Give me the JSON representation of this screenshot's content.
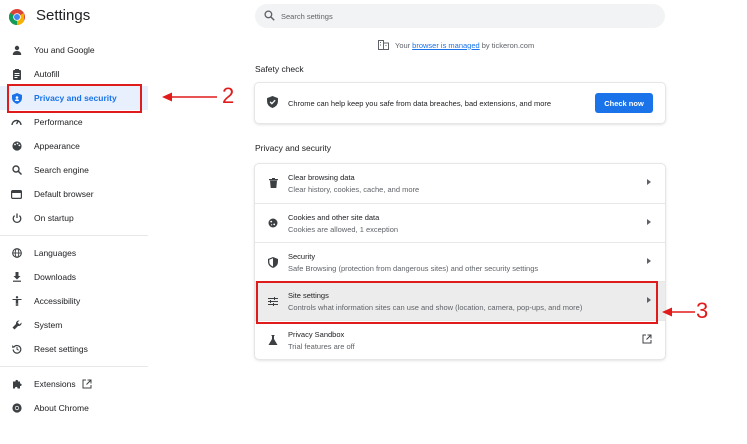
{
  "header": {
    "title": "Settings",
    "logo_icon": "chrome-logo-icon"
  },
  "sidebar": {
    "items": [
      {
        "label": "You and Google",
        "icon": "person-icon"
      },
      {
        "label": "Autofill",
        "icon": "clipboard-icon"
      },
      {
        "label": "Privacy and security",
        "icon": "shield-icon",
        "active": true
      },
      {
        "label": "Performance",
        "icon": "gauge-icon"
      },
      {
        "label": "Appearance",
        "icon": "palette-icon"
      },
      {
        "label": "Search engine",
        "icon": "search-icon"
      },
      {
        "label": "Default browser",
        "icon": "browser-icon"
      },
      {
        "label": "On startup",
        "icon": "power-icon"
      },
      {
        "label": "Languages",
        "icon": "globe-icon"
      },
      {
        "label": "Downloads",
        "icon": "download-icon"
      },
      {
        "label": "Accessibility",
        "icon": "accessibility-icon"
      },
      {
        "label": "System",
        "icon": "wrench-icon"
      },
      {
        "label": "Reset settings",
        "icon": "reset-icon"
      },
      {
        "label": "Extensions",
        "icon": "puzzle-icon",
        "external": true
      },
      {
        "label": "About Chrome",
        "icon": "chrome-icon"
      }
    ]
  },
  "search": {
    "placeholder": "Search settings"
  },
  "managed": {
    "prefix": "Your",
    "link": "browser is managed",
    "suffix": "by tickeron.com"
  },
  "safety_check": {
    "title": "Safety check",
    "text": "Chrome can help keep you safe from data breaches, bad extensions, and more",
    "button": "Check now"
  },
  "privacy": {
    "title": "Privacy and security",
    "rows": [
      {
        "title": "Clear browsing data",
        "subtitle": "Clear history, cookies, cache, and more",
        "icon": "trash-icon"
      },
      {
        "title": "Cookies and other site data",
        "subtitle": "Cookies are allowed, 1 exception",
        "icon": "cookie-icon"
      },
      {
        "title": "Security",
        "subtitle": "Safe Browsing (protection from dangerous sites) and other security settings",
        "icon": "shield-icon"
      },
      {
        "title": "Site settings",
        "subtitle": "Controls what information sites can use and show (location, camera, pop-ups, and more)",
        "icon": "tune-icon"
      },
      {
        "title": "Privacy Sandbox",
        "subtitle": "Trial features are off",
        "icon": "flask-icon"
      }
    ]
  },
  "annotations": {
    "step2": "2",
    "step3": "3",
    "color": "#e01b1b"
  },
  "colors": {
    "accent": "#1a73e8",
    "text": "#202124",
    "secondary": "#5f6368"
  }
}
